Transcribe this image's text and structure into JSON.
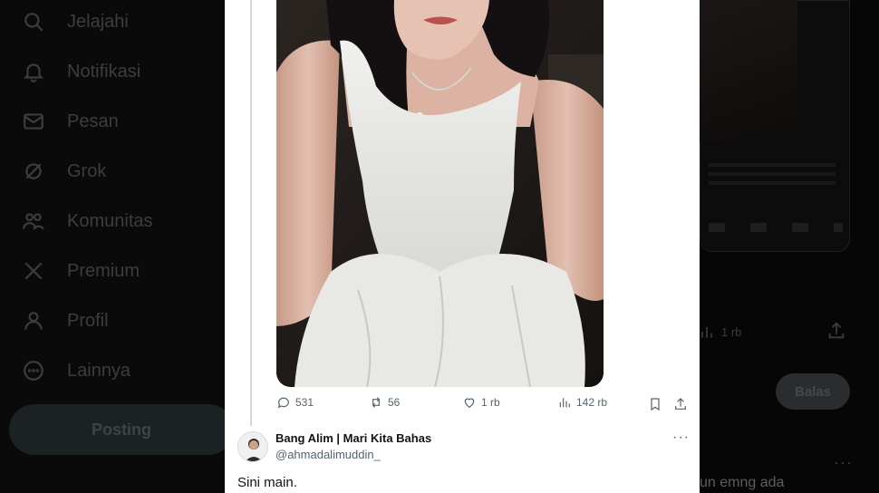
{
  "nav": {
    "items": [
      {
        "label": "Jelajahi",
        "icon": "search-icon"
      },
      {
        "label": "Notifikasi",
        "icon": "bell-icon"
      },
      {
        "label": "Pesan",
        "icon": "mail-icon"
      },
      {
        "label": "Grok",
        "icon": "grok-icon"
      },
      {
        "label": "Komunitas",
        "icon": "people-icon"
      },
      {
        "label": "Premium",
        "icon": "x-logo-icon"
      },
      {
        "label": "Profil",
        "icon": "person-icon"
      },
      {
        "label": "Lainnya",
        "icon": "more-circle-icon"
      }
    ],
    "post_button": "Posting"
  },
  "post": {
    "stats": {
      "replies": "531",
      "reposts": "56",
      "likes": "1 rb",
      "views": "142 rb"
    }
  },
  "reply": {
    "name": "Bang Alim | Mari Kita Bahas",
    "handle": "@ahmadalimuddin_",
    "text": "Sini main.",
    "more": "···"
  },
  "background": {
    "stat_count": "1 rb",
    "reply_button": "Balas",
    "more": "···",
    "snippet": "un emng ada"
  },
  "colors": {
    "accent": "#1d9bf0",
    "modal_bg": "#ffffff",
    "backdrop": "#000000"
  }
}
